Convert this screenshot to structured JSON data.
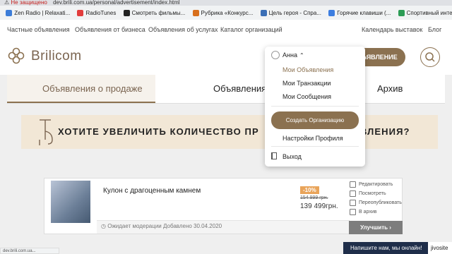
{
  "browser": {
    "security": "Не защищено",
    "url": "dev.brili.com.ua/personal/advertisement/index.html",
    "bookmarks": [
      {
        "label": "Zen Radio | Relaxati...",
        "color": "#3c7dd8"
      },
      {
        "label": "RadioTunes",
        "color": "#e23d3d"
      },
      {
        "label": "Смотреть фильмы...",
        "color": "#222222"
      },
      {
        "label": "Рубрика «Конкурс...",
        "color": "#d86f1c"
      },
      {
        "label": "Цель героя - Спра...",
        "color": "#3b6fb6"
      },
      {
        "label": "Горячие клавиши (...",
        "color": "#3d7ee0"
      },
      {
        "label": "Спортивный интер...",
        "color": "#2c9c55"
      }
    ],
    "status_url": "dev.brili.com.ua..."
  },
  "topnav": {
    "items": [
      "Частные объявления",
      "Объявления от бизнеса",
      "Объявления об услугах",
      "Каталог организаций"
    ],
    "right_items": [
      "Календарь выставок",
      "Блог"
    ]
  },
  "header": {
    "logo": "Brilicom",
    "cta_label": "ЪЯВЛЕНИЕ",
    "search_icon": "search-icon"
  },
  "tabs": {
    "items": [
      "Объявления о продаже",
      "Объявления",
      "Архив"
    ],
    "active_index": 0
  },
  "banner": {
    "text_left": "ХОТИТЕ УВЕЛИЧИТЬ КОЛИЧЕСТВО ПР",
    "text_right": "ВЛЕНИЯ?"
  },
  "ad": {
    "title": "Кулон с драгоценным камнем",
    "discount": "-10%",
    "old_price": "154 999 грн.",
    "price": "139 499грн.",
    "status": "Ожидает модерации Добавлено 30.04.2020",
    "actions": [
      "Редактировать",
      "Посмотреть",
      "Переопубликовать",
      "В архив"
    ],
    "promote_label": "Улучшить ›"
  },
  "dropdown": {
    "user_name": "Анна",
    "items": [
      "Мои Объявления",
      "Мои Транзакции",
      "Мои Сообщения"
    ],
    "create_org": "Создать Организацию",
    "settings": "Настройки Профиля",
    "logout": "Выход"
  },
  "chat": {
    "label": "Напишите нам, мы онлайн!",
    "brand": "jivosite"
  },
  "colors": {
    "accent": "#8b7150",
    "banner_bg": "#f2e7d6",
    "discount": "#e9a45a"
  }
}
